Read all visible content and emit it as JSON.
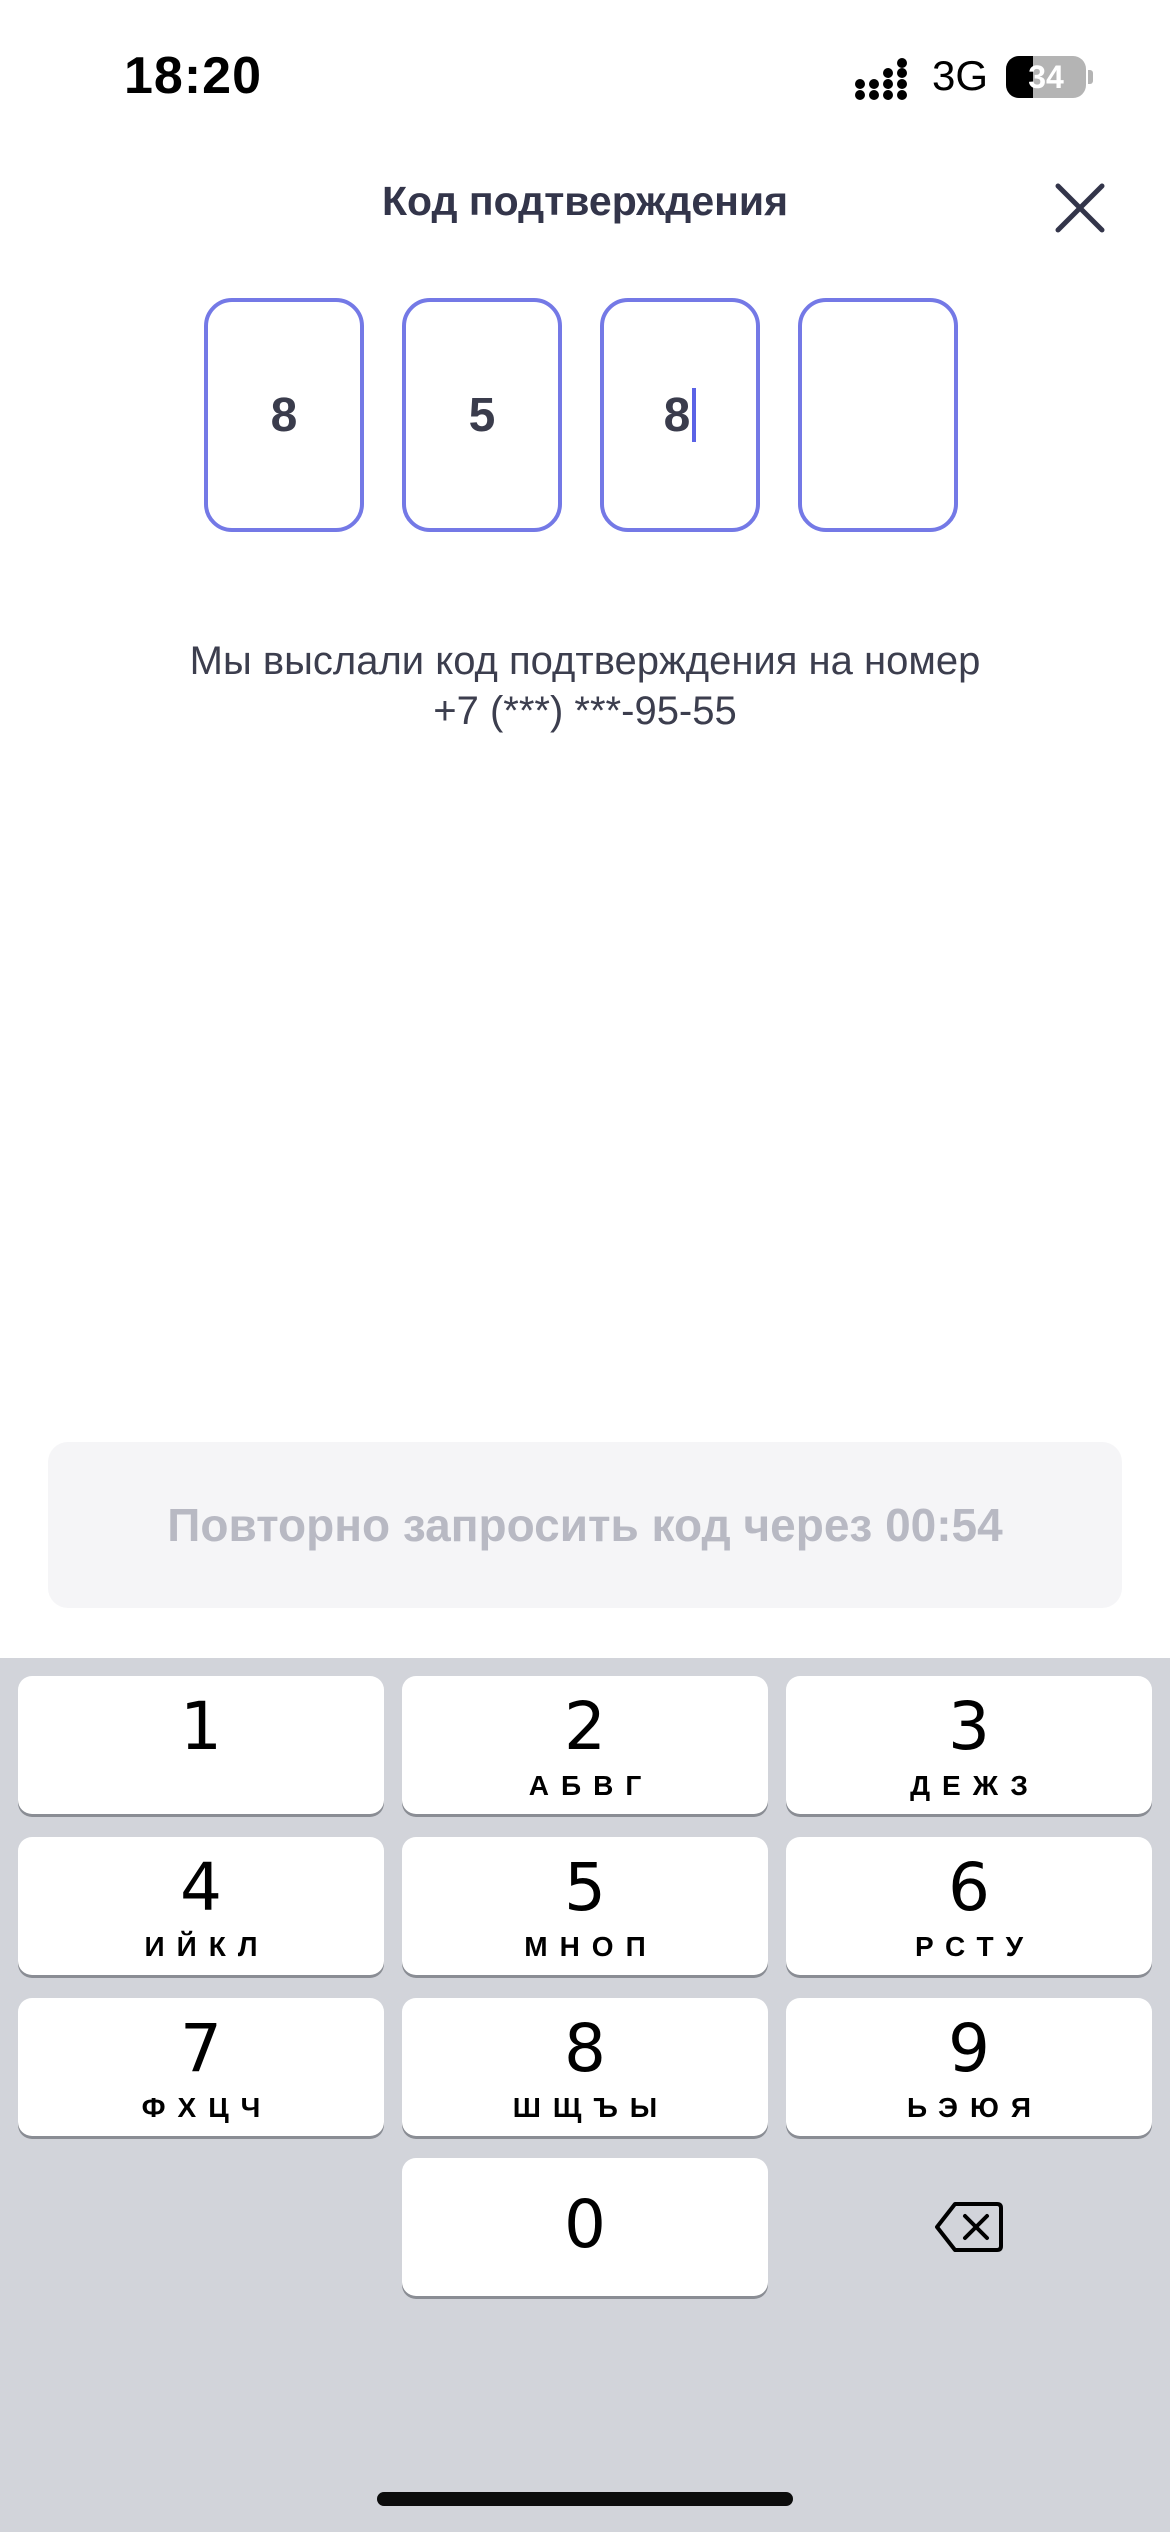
{
  "status_bar": {
    "time": "18:20",
    "network": "3G",
    "battery_percent": "34",
    "battery_level": 0.34
  },
  "header": {
    "title": "Код подтверждения",
    "close_icon": "close-icon"
  },
  "code": {
    "digits": [
      "8",
      "5",
      "8",
      ""
    ],
    "active_index": 2
  },
  "message": {
    "line1": "Мы выслали код подтверждения на номер",
    "line2": "+7 (***) ***-95-55"
  },
  "resend": {
    "label": "Повторно запросить код через 00:54"
  },
  "keyboard": {
    "keys": [
      {
        "num": "1",
        "letters": ""
      },
      {
        "num": "2",
        "letters": "АБВГ"
      },
      {
        "num": "3",
        "letters": "ДЕЖЗ"
      },
      {
        "num": "4",
        "letters": "ИЙКЛ"
      },
      {
        "num": "5",
        "letters": "МНОП"
      },
      {
        "num": "6",
        "letters": "РСТУ"
      },
      {
        "num": "7",
        "letters": "ФХЦЧ"
      },
      {
        "num": "8",
        "letters": "ШЩЪЫ"
      },
      {
        "num": "9",
        "letters": "ЬЭЮЯ"
      },
      {
        "num": "0",
        "letters": ""
      }
    ],
    "backspace_icon": "backspace-icon"
  },
  "colors": {
    "accent": "#7479e6",
    "cursor": "#5b63e6",
    "keyboard_bg": "#d2d4da",
    "resend_bg": "#f5f5f7",
    "resend_text": "#b8b9c3"
  }
}
